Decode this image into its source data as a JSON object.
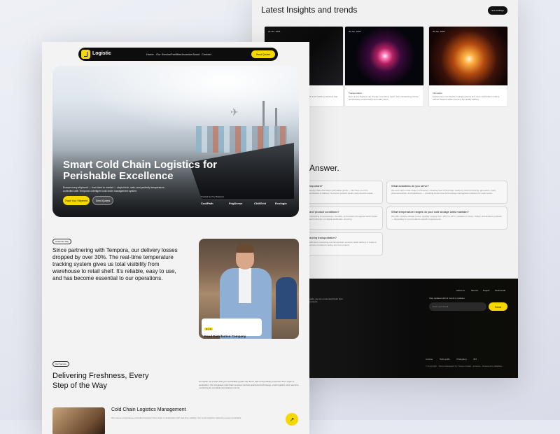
{
  "back": {
    "insights_title": "Latest Insights and trends",
    "see_all": "See All Blogs",
    "cards": [
      {
        "date": "20 Jan, 2026",
        "tag": "",
        "text": "Insulated temperature-controlled sensors, and cloud tracking solutions that help keep perishable goods transport"
      },
      {
        "date": "20 Jan, 2026",
        "tag": "Transportation",
        "text": "Even a few degrees can change everything. Learn how maintaining precise temperature control keeps food safe, fresh"
      },
      {
        "date": "20 Jan, 2026",
        "tag": "Innovation",
        "text": "Explore how eco-friendly cooling systems and route optimization reduce carbon footprint while ensuring top quality delivery"
      }
    ],
    "answer_title": "Answer.",
    "faqs": [
      {
        "q": "important?",
        "a": "supply chain that keeps perishable goods — like food, bio from production to delivery. It ensures product quality and prevents waste."
      },
      {
        "q": "What industries do you serve?",
        "a": "We work with a wide range of industries, including food & beverage, seafood, meat processing, agriculture, dairy, pharmaceuticals, and healthcare — providing customized cold storage and logistics solutions for each sector."
      },
      {
        "q": "and product conditions?",
        "a": "monitoring of temperature, humidity, and location throughout send instant alerts through our digital dashboard, ensuring"
      },
      {
        "q": "What temperature ranges do your cold storage units maintain?",
        "a": "We offer multiple storage zones, typically ranging from -25°C to +8°C, suitable for frozen, chilled, and ambient products — depending on your product's specific requirements."
      },
      {
        "q": "during transportation?",
        "a": "with strict monitoring and temperature sensors. Each delivery is ready to ensure consistent cooling and zero product"
      }
    ],
    "footer": {
      "nav": [
        "About us",
        "Service",
        "Project",
        "Testimonial"
      ],
      "left_text": "uality, we are on-demand fresh from products",
      "stay": "Stay updated with Al trends & updates",
      "email_placeholder": "Enter your Email",
      "send": "Send",
      "links": [
        "License",
        "Style guide",
        "Changelog",
        "404"
      ],
      "copyright": "© Copyright - Tempo Designed by: Tempo Insider - License - Powered by Webflow"
    }
  },
  "front": {
    "brand": "Logistic",
    "nav": [
      "Home",
      "Our Service",
      "Facilities",
      "Investor",
      "About",
      "Contact"
    ],
    "quote_btn": "Send Quotes",
    "hero_title": "Smart Cold Chain Logistics for Perishable Excellence",
    "hero_sub": "Ensure every shipment — from farm to market — stays fresh, safe, and perfectly temperature-controlled with Tempora's intelligent cold chain management system.",
    "track_btn": "Track Your Shipment",
    "send_btn": "Send Quotes",
    "trusted": "Trusted by 70+ Business",
    "partners": [
      "CoolPath",
      "FrigSense",
      "ChillGrid",
      "Ecologix"
    ],
    "testimonial_tag": "Customer Say",
    "testimonial": "Since partnering with Tempora, our delivery losses dropped by over 30%. The real-time temperature tracking system gives us total visibility from warehouse to retail shelf. It's reliable, easy to use, and has become essential to our operations.",
    "rating": "★ 4.8",
    "company": "Food Distribution Company",
    "role": "Martin Sabila, Operations Manager, FreshFields Foods",
    "service_tag": "Our Service",
    "service_title": "Delivering Freshness, Every Step of the Way",
    "service_text": "At logistic, we ensure that your perishable goods stay fresh, safe and perfectly preserved from origin to destination. Our integrated cold chain services combine advanced technology, smart logistics, and real-time monitoring for complete temperature control.",
    "service_item_title": "Cold Chain Logistics Management",
    "service_item_sub": "We ensure temperature-controlled transport from origin to destination with real-time visibility. Our smart logistics network ensures perishable",
    "arrow": "↗"
  }
}
